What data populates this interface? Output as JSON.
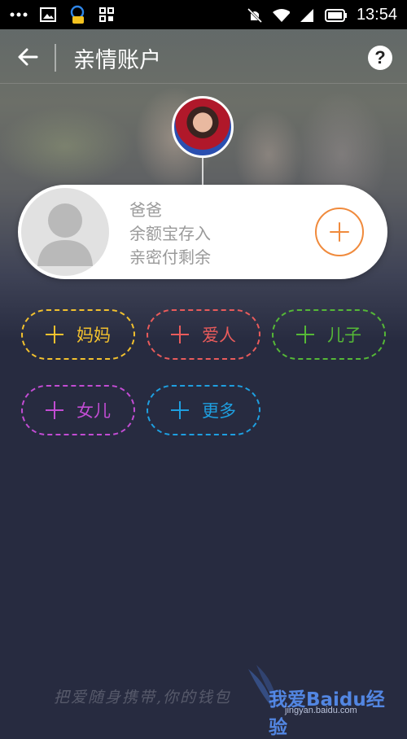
{
  "status_bar": {
    "time": "13:54",
    "icons": [
      "more-dots-icon",
      "gallery-icon",
      "assistant-icon",
      "grid-icon",
      "mute-icon",
      "wifi-icon",
      "signal-icon",
      "battery-icon"
    ]
  },
  "header": {
    "title": "亲情账户",
    "back_icon": "back-arrow-icon",
    "help_icon": "help-icon",
    "help_label": "?"
  },
  "family_card": {
    "name": "爸爸",
    "line2": "余额宝存入",
    "line3": "亲密付剩余",
    "add_icon": "plus-icon"
  },
  "chips": [
    {
      "label": "妈妈",
      "color": "#f2c12e"
    },
    {
      "label": "爱人",
      "color": "#e95b5b"
    },
    {
      "label": "儿子",
      "color": "#55b837"
    },
    {
      "label": "女儿",
      "color": "#c24cd3"
    },
    {
      "label": "更多",
      "color": "#1e9fe0"
    }
  ],
  "watermark": {
    "slogan": "把爱随身携带,你的钱包",
    "brand": "我爱Baidu经验",
    "url": "jingyan.baidu.com"
  },
  "colors": {
    "background": "#272b40",
    "accent_orange": "#f08a3c"
  }
}
